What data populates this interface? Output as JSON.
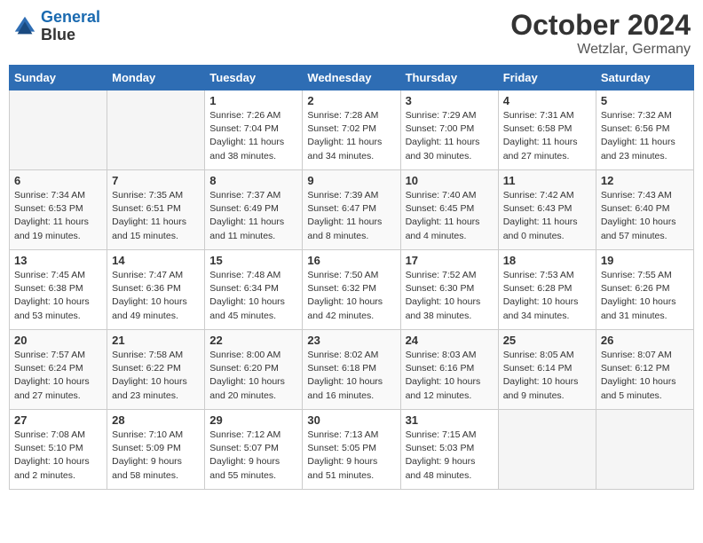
{
  "header": {
    "logo_line1": "General",
    "logo_line2": "Blue",
    "month": "October 2024",
    "location": "Wetzlar, Germany"
  },
  "weekdays": [
    "Sunday",
    "Monday",
    "Tuesday",
    "Wednesday",
    "Thursday",
    "Friday",
    "Saturday"
  ],
  "weeks": [
    [
      {
        "day": "",
        "sunrise": "",
        "sunset": "",
        "daylight": "",
        "empty": true
      },
      {
        "day": "",
        "sunrise": "",
        "sunset": "",
        "daylight": "",
        "empty": true
      },
      {
        "day": "1",
        "sunrise": "Sunrise: 7:26 AM",
        "sunset": "Sunset: 7:04 PM",
        "daylight": "Daylight: 11 hours and 38 minutes."
      },
      {
        "day": "2",
        "sunrise": "Sunrise: 7:28 AM",
        "sunset": "Sunset: 7:02 PM",
        "daylight": "Daylight: 11 hours and 34 minutes."
      },
      {
        "day": "3",
        "sunrise": "Sunrise: 7:29 AM",
        "sunset": "Sunset: 7:00 PM",
        "daylight": "Daylight: 11 hours and 30 minutes."
      },
      {
        "day": "4",
        "sunrise": "Sunrise: 7:31 AM",
        "sunset": "Sunset: 6:58 PM",
        "daylight": "Daylight: 11 hours and 27 minutes."
      },
      {
        "day": "5",
        "sunrise": "Sunrise: 7:32 AM",
        "sunset": "Sunset: 6:56 PM",
        "daylight": "Daylight: 11 hours and 23 minutes."
      }
    ],
    [
      {
        "day": "6",
        "sunrise": "Sunrise: 7:34 AM",
        "sunset": "Sunset: 6:53 PM",
        "daylight": "Daylight: 11 hours and 19 minutes."
      },
      {
        "day": "7",
        "sunrise": "Sunrise: 7:35 AM",
        "sunset": "Sunset: 6:51 PM",
        "daylight": "Daylight: 11 hours and 15 minutes."
      },
      {
        "day": "8",
        "sunrise": "Sunrise: 7:37 AM",
        "sunset": "Sunset: 6:49 PM",
        "daylight": "Daylight: 11 hours and 11 minutes."
      },
      {
        "day": "9",
        "sunrise": "Sunrise: 7:39 AM",
        "sunset": "Sunset: 6:47 PM",
        "daylight": "Daylight: 11 hours and 8 minutes."
      },
      {
        "day": "10",
        "sunrise": "Sunrise: 7:40 AM",
        "sunset": "Sunset: 6:45 PM",
        "daylight": "Daylight: 11 hours and 4 minutes."
      },
      {
        "day": "11",
        "sunrise": "Sunrise: 7:42 AM",
        "sunset": "Sunset: 6:43 PM",
        "daylight": "Daylight: 11 hours and 0 minutes."
      },
      {
        "day": "12",
        "sunrise": "Sunrise: 7:43 AM",
        "sunset": "Sunset: 6:40 PM",
        "daylight": "Daylight: 10 hours and 57 minutes."
      }
    ],
    [
      {
        "day": "13",
        "sunrise": "Sunrise: 7:45 AM",
        "sunset": "Sunset: 6:38 PM",
        "daylight": "Daylight: 10 hours and 53 minutes."
      },
      {
        "day": "14",
        "sunrise": "Sunrise: 7:47 AM",
        "sunset": "Sunset: 6:36 PM",
        "daylight": "Daylight: 10 hours and 49 minutes."
      },
      {
        "day": "15",
        "sunrise": "Sunrise: 7:48 AM",
        "sunset": "Sunset: 6:34 PM",
        "daylight": "Daylight: 10 hours and 45 minutes."
      },
      {
        "day": "16",
        "sunrise": "Sunrise: 7:50 AM",
        "sunset": "Sunset: 6:32 PM",
        "daylight": "Daylight: 10 hours and 42 minutes."
      },
      {
        "day": "17",
        "sunrise": "Sunrise: 7:52 AM",
        "sunset": "Sunset: 6:30 PM",
        "daylight": "Daylight: 10 hours and 38 minutes."
      },
      {
        "day": "18",
        "sunrise": "Sunrise: 7:53 AM",
        "sunset": "Sunset: 6:28 PM",
        "daylight": "Daylight: 10 hours and 34 minutes."
      },
      {
        "day": "19",
        "sunrise": "Sunrise: 7:55 AM",
        "sunset": "Sunset: 6:26 PM",
        "daylight": "Daylight: 10 hours and 31 minutes."
      }
    ],
    [
      {
        "day": "20",
        "sunrise": "Sunrise: 7:57 AM",
        "sunset": "Sunset: 6:24 PM",
        "daylight": "Daylight: 10 hours and 27 minutes."
      },
      {
        "day": "21",
        "sunrise": "Sunrise: 7:58 AM",
        "sunset": "Sunset: 6:22 PM",
        "daylight": "Daylight: 10 hours and 23 minutes."
      },
      {
        "day": "22",
        "sunrise": "Sunrise: 8:00 AM",
        "sunset": "Sunset: 6:20 PM",
        "daylight": "Daylight: 10 hours and 20 minutes."
      },
      {
        "day": "23",
        "sunrise": "Sunrise: 8:02 AM",
        "sunset": "Sunset: 6:18 PM",
        "daylight": "Daylight: 10 hours and 16 minutes."
      },
      {
        "day": "24",
        "sunrise": "Sunrise: 8:03 AM",
        "sunset": "Sunset: 6:16 PM",
        "daylight": "Daylight: 10 hours and 12 minutes."
      },
      {
        "day": "25",
        "sunrise": "Sunrise: 8:05 AM",
        "sunset": "Sunset: 6:14 PM",
        "daylight": "Daylight: 10 hours and 9 minutes."
      },
      {
        "day": "26",
        "sunrise": "Sunrise: 8:07 AM",
        "sunset": "Sunset: 6:12 PM",
        "daylight": "Daylight: 10 hours and 5 minutes."
      }
    ],
    [
      {
        "day": "27",
        "sunrise": "Sunrise: 7:08 AM",
        "sunset": "Sunset: 5:10 PM",
        "daylight": "Daylight: 10 hours and 2 minutes."
      },
      {
        "day": "28",
        "sunrise": "Sunrise: 7:10 AM",
        "sunset": "Sunset: 5:09 PM",
        "daylight": "Daylight: 9 hours and 58 minutes."
      },
      {
        "day": "29",
        "sunrise": "Sunrise: 7:12 AM",
        "sunset": "Sunset: 5:07 PM",
        "daylight": "Daylight: 9 hours and 55 minutes."
      },
      {
        "day": "30",
        "sunrise": "Sunrise: 7:13 AM",
        "sunset": "Sunset: 5:05 PM",
        "daylight": "Daylight: 9 hours and 51 minutes."
      },
      {
        "day": "31",
        "sunrise": "Sunrise: 7:15 AM",
        "sunset": "Sunset: 5:03 PM",
        "daylight": "Daylight: 9 hours and 48 minutes."
      },
      {
        "day": "",
        "sunrise": "",
        "sunset": "",
        "daylight": "",
        "empty": true
      },
      {
        "day": "",
        "sunrise": "",
        "sunset": "",
        "daylight": "",
        "empty": true
      }
    ]
  ]
}
